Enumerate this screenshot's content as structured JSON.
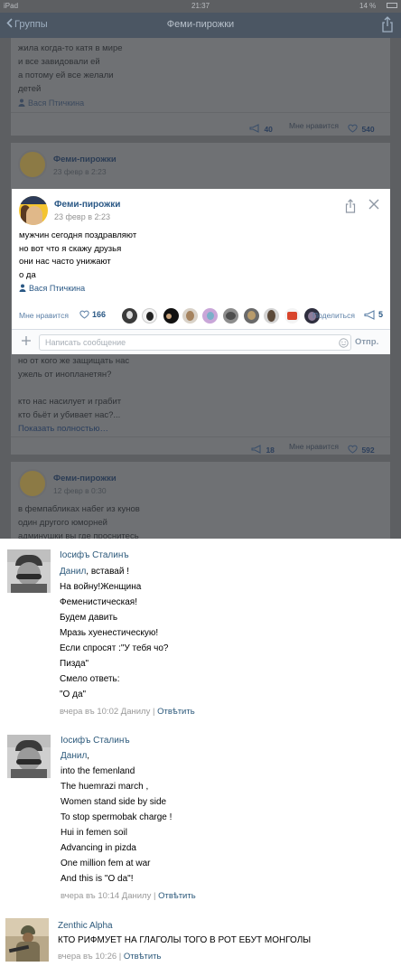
{
  "status_bar": {
    "carrier": "iPad",
    "time": "21:37",
    "battery": "14 %"
  },
  "nav": {
    "back_label": "Группы",
    "title": "Феми-пирожки"
  },
  "feed_top": {
    "text_lines": [
      "жила когда-то катя в мире",
      "и все завидовали ей",
      "а потому ей все желали",
      "детей"
    ],
    "author": "Вася Птичкина",
    "shares": "40",
    "likes_label": "Мне нравится",
    "likes": "540"
  },
  "feed_post2": {
    "group": "Феми-пирожки",
    "date": "23 февр в 2:23"
  },
  "modal": {
    "group": "Феми-пирожки",
    "date": "23 февр в 2:23",
    "text_lines": [
      "мужчин сегодня поздравляют",
      "но вот что я скажу друзья",
      "они нас часто унижают",
      "о да"
    ],
    "author": "Вася Птичкина",
    "likes_label": "Мне нравится",
    "likes": "166",
    "share_label": "Поделиться",
    "shares": "5",
    "input_placeholder": "Написать сообщение",
    "send_label": "Отпр."
  },
  "feed_below": {
    "text_lines": [
      "но от кого же защищать нас",
      "ужель от инопланетян?",
      "",
      "кто нас насилует и грабит",
      "кто бьёт и убивает нас?..."
    ],
    "show_more": "Показать полностью…",
    "shares": "18",
    "likes_label": "Мне нравится",
    "likes": "592"
  },
  "feed_post3": {
    "group": "Феми-пирожки",
    "date": "12 февр в 0:30",
    "text_lines": [
      "в фемпабликах набег из кунов",
      "один другого юморней",
      "админушки вы где проснитесь"
    ]
  },
  "comments": [
    {
      "author": "Іосифъ Сталинъ",
      "mention": "Данил",
      "first_rest": ", вставай !",
      "lines": [
        "На войну!Женщина",
        "Феменистическая!",
        "Будем давить",
        "Мразь хуенестическую!",
        "Если спросят :\"У тебя чо?",
        "Пизда\"",
        "Смело ответь:",
        "\"О да\""
      ],
      "time": "вчера въ 10:02 Данилу",
      "reply": "Отвѣтить"
    },
    {
      "author": "Іосифъ Сталинъ",
      "mention": "Данил",
      "first_rest": ",",
      "lines": [
        "into the femenland",
        "The huemrazi march ,",
        "Women stand side by side",
        "To stop spermobak charge !",
        "Hui in femen soil",
        "Advancing in pizda",
        "One million fem at war",
        "And this is \"O da\"!"
      ],
      "time": "вчера въ 10:14 Данилу",
      "reply": "Отвѣтить"
    },
    {
      "author": "Zenthic Alpha",
      "lines": [
        "КТО РИФМУЕТ НА ГЛАГОЛЫ ТОГО В РОТ ЕБУТ МОНГОЛЫ"
      ],
      "time": "вчера въ 10:26",
      "reply": "Отвѣтить"
    }
  ],
  "colors": {
    "link": "#2b587a",
    "overlay": "#5d5f62",
    "navbar": "#4b5663"
  },
  "icons": [
    "chevron-left-icon",
    "share-icon",
    "person-icon",
    "megaphone-icon",
    "heart-icon",
    "close-icon",
    "plus-icon",
    "smile-icon"
  ]
}
